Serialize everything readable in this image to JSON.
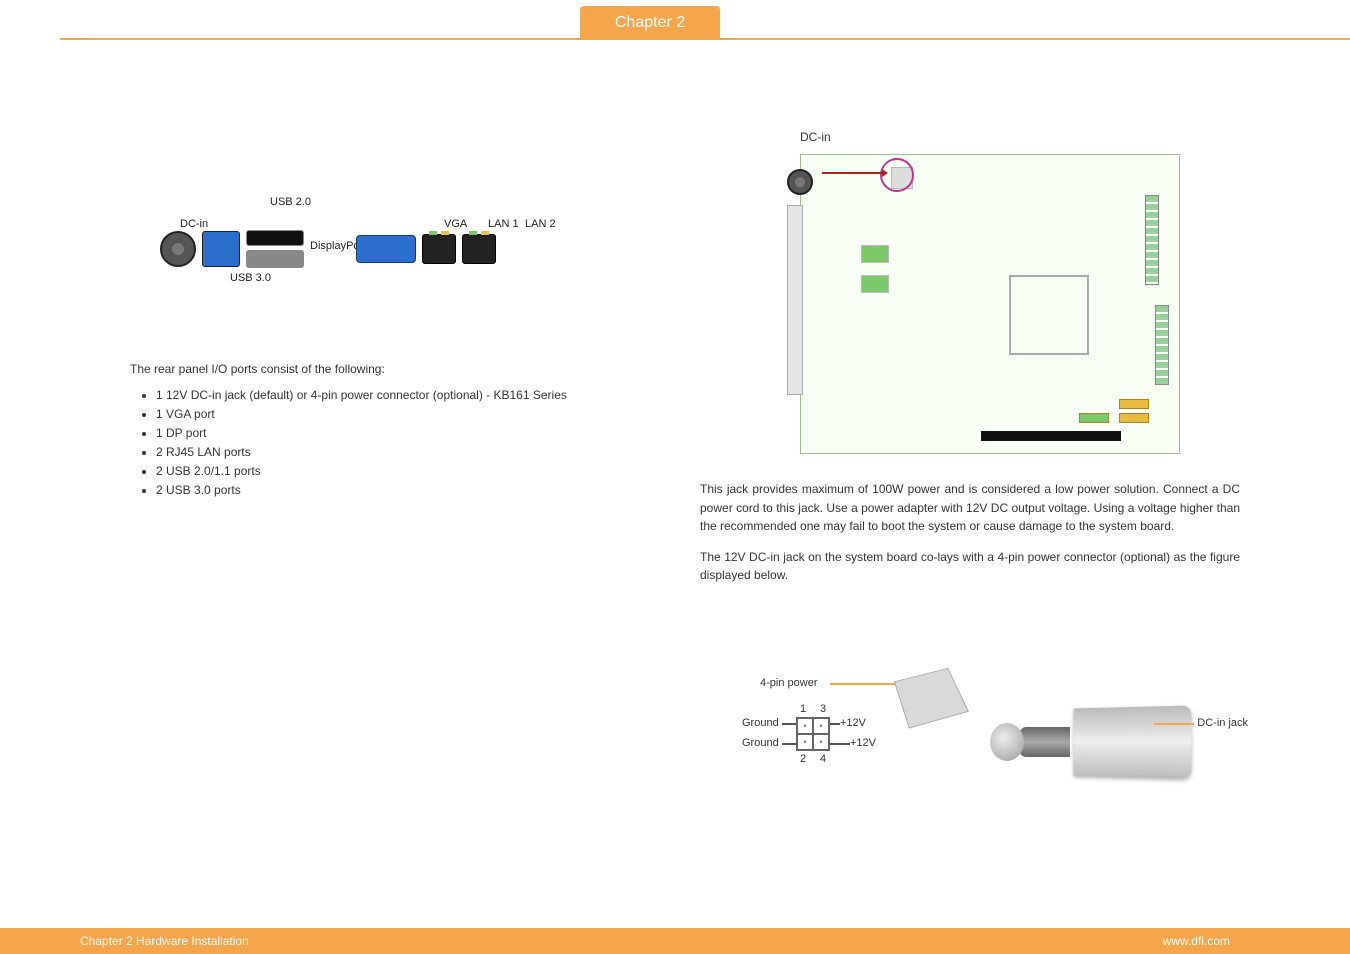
{
  "header": {
    "chapter_tab": "Chapter 2"
  },
  "left": {
    "rear_panel_labels": {
      "dc_in": "DC-in",
      "usb2": "USB 2.0",
      "displayport": "DisplayPort",
      "usb3": "USB 3.0",
      "vga": "VGA",
      "lan1": "LAN 1",
      "lan2": "LAN 2"
    },
    "intro": "The rear panel I/O ports consist of the following:",
    "bullets": [
      "1 12V DC-in jack (default) or 4-pin power connector (optional) - KB161 Series",
      "1 VGA port",
      "1 DP port",
      "2 RJ45 LAN ports",
      "2 USB 2.0/1.1 ports",
      "2 USB 3.0 ports"
    ]
  },
  "right": {
    "board_label": "DC-in",
    "para1": "This jack provides maximum of 100W power and is considered a low power solution. Connect a DC power cord to this jack. Use a power adapter with 12V DC output voltage. Using a voltage higher than the recommended one may fail to boot the system or cause damage to the system board.",
    "para2": "The 12V DC-in jack on the system board co-lays with a 4-pin power connector (optional) as the figure displayed below.",
    "pin_figure": {
      "title": "4-pin power",
      "pin1_label": "1",
      "pin2_label": "2",
      "pin3_label": "3",
      "pin4_label": "4",
      "ground": "Ground",
      "plus12v": "+12V",
      "dc_in_jack": "DC-in jack"
    }
  },
  "footer": {
    "left": "Chapter 2 Hardware Installation",
    "right": "www.dfi.com"
  }
}
